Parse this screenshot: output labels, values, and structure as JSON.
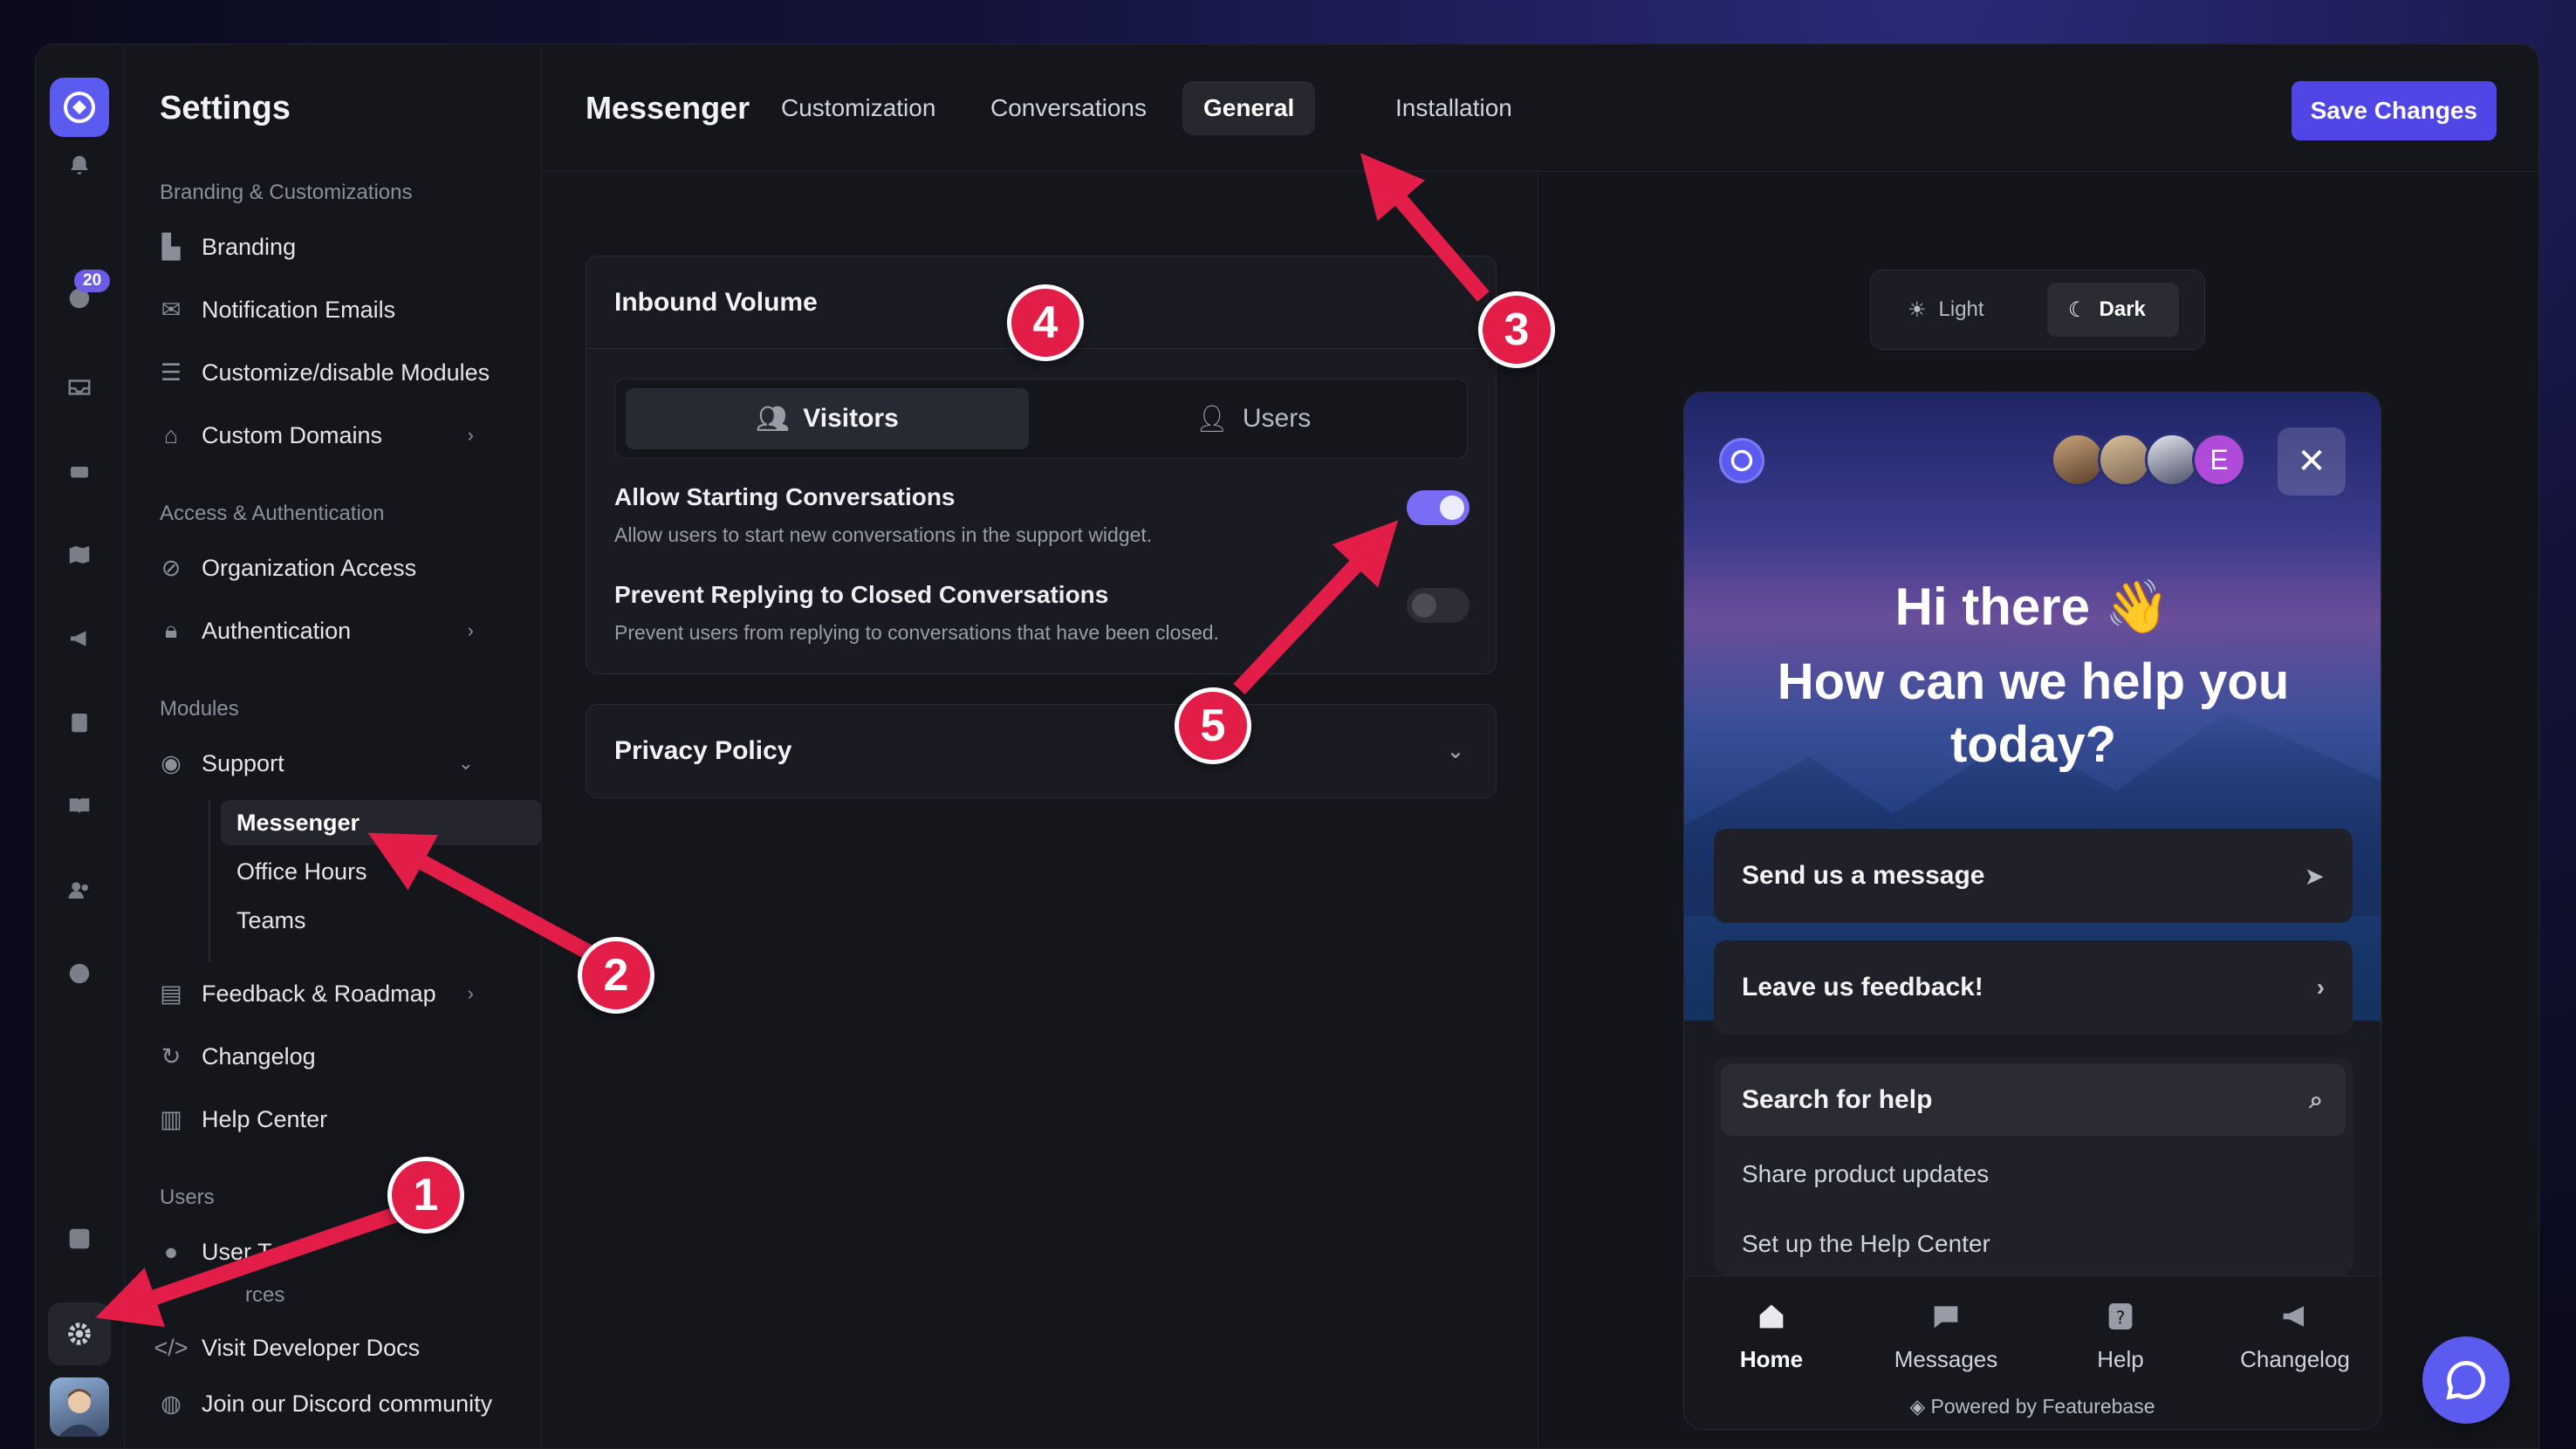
{
  "sidebar": {
    "title": "Settings",
    "sections": {
      "branding": "Branding & Customizations",
      "access": "Access & Authentication",
      "modules": "Modules",
      "users": "Users",
      "resources": "rces"
    },
    "items": {
      "branding": "Branding",
      "notification_emails": "Notification Emails",
      "modules": "Customize/disable Modules",
      "domains": "Custom Domains",
      "org_access": "Organization Access",
      "authentication": "Authentication",
      "support": "Support",
      "messenger": "Messenger",
      "office_hours": "Office Hours",
      "teams": "Teams",
      "feedback": "Feedback & Roadmap",
      "changelog": "Changelog",
      "help_center": "Help Center",
      "user_t": "User T",
      "dev_docs": "Visit Developer Docs",
      "discord": "Join our Discord community"
    }
  },
  "rail": {
    "badge": "20"
  },
  "topbar": {
    "title": "Messenger",
    "tabs": [
      "Customization",
      "Conversations",
      "General",
      "Installation"
    ],
    "active_tab": "General",
    "save": "Save Changes"
  },
  "inbound": {
    "title": "Inbound Volume",
    "segments": [
      "Visitors",
      "Users"
    ],
    "active_segment": "Visitors",
    "settings": [
      {
        "title": "Allow Starting Conversations",
        "desc": "Allow users to start new conversations in the support widget.",
        "enabled": true
      },
      {
        "title": "Prevent Replying to Closed Conversations",
        "desc": "Prevent users from replying to conversations that have been closed.",
        "enabled": false
      }
    ]
  },
  "privacy": {
    "title": "Privacy Policy"
  },
  "preview": {
    "theme": [
      "Light",
      "Dark"
    ],
    "active_theme": "Dark",
    "avatar_letter": "E",
    "greeting": "Hi there 👋",
    "headline": "How can we help you today?",
    "buttons": [
      "Send us a message",
      "Leave us feedback!"
    ],
    "search": "Search for help",
    "articles": [
      "Share product updates",
      "Set up the Help Center"
    ],
    "nav": [
      "Home",
      "Messages",
      "Help",
      "Changelog"
    ],
    "active_nav": "Home",
    "powered": "Powered by Featurebase"
  },
  "annotations": [
    "1",
    "2",
    "3",
    "4",
    "5"
  ],
  "colors": {
    "accent": "#5046e5",
    "annotation": "#e11d48",
    "toggle_on": "#7b6cf6"
  }
}
